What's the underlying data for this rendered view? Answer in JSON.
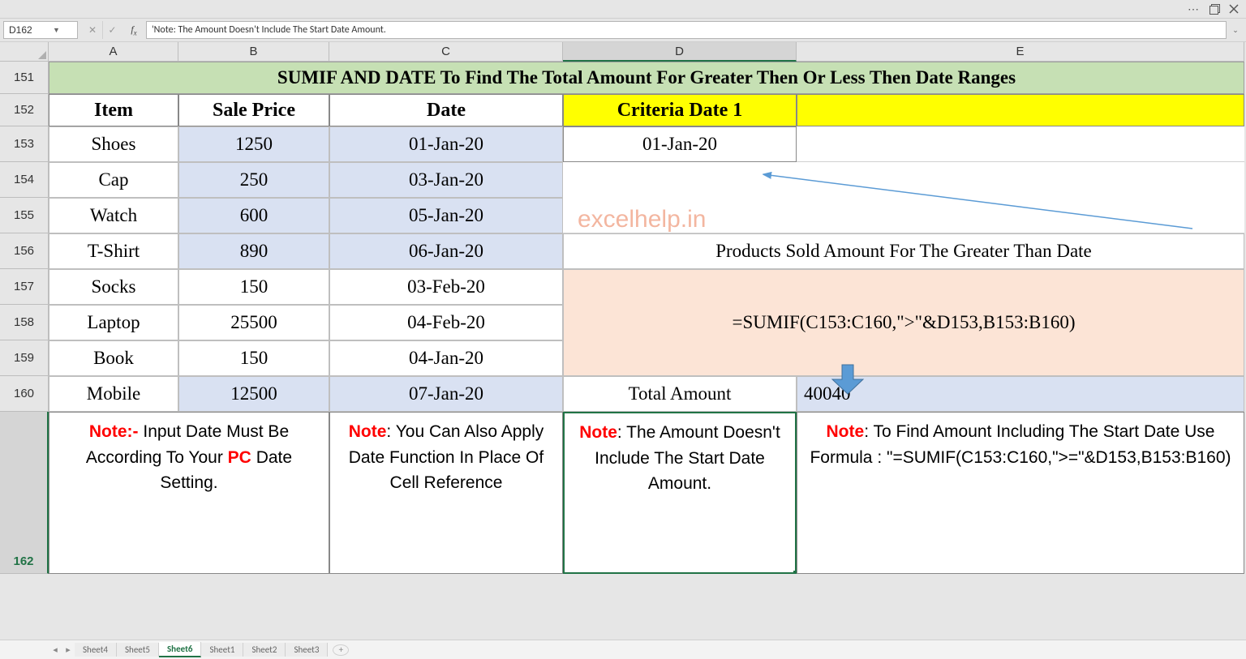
{
  "window": {
    "dots": "⋯"
  },
  "nameBox": "D162",
  "formulaBar": "'Note: The Amount Doesn't Include The Start Date Amount.",
  "columns": [
    "A",
    "B",
    "C",
    "D",
    "E"
  ],
  "rowNums": [
    "151",
    "152",
    "153",
    "154",
    "155",
    "156",
    "157",
    "158",
    "159",
    "160",
    "162"
  ],
  "title": "SUMIF AND DATE To Find The Total Amount For Greater Then Or Less Then Date Ranges",
  "headers": {
    "item": "Item",
    "sale": "Sale Price",
    "date": "Date",
    "crit": "Criteria Date 1"
  },
  "criteriaDateValue": "01-Jan-20",
  "productsLabel": "Products Sold Amount For The Greater Than Date",
  "formulaShown": "=SUMIF(C153:C160,\">\"&D153,B153:B160)",
  "totalLabel": "Total Amount",
  "totalValue": "40040",
  "watermark": "excelhelp.in",
  "rows": [
    {
      "item": "Shoes",
      "price": "1250",
      "date": "01-Jan-20",
      "blue": true
    },
    {
      "item": "Cap",
      "price": "250",
      "date": "03-Jan-20",
      "blue": true
    },
    {
      "item": "Watch",
      "price": "600",
      "date": "05-Jan-20",
      "blue": true
    },
    {
      "item": "T-Shirt",
      "price": "890",
      "date": "06-Jan-20",
      "blue": true
    },
    {
      "item": "Socks",
      "price": "150",
      "date": "03-Feb-20",
      "blue": false
    },
    {
      "item": "Laptop",
      "price": "25500",
      "date": "04-Feb-20",
      "blue": false
    },
    {
      "item": "Book",
      "price": "150",
      "date": "04-Jan-20",
      "blue": false
    },
    {
      "item": "Mobile",
      "price": "12500",
      "date": "07-Jan-20",
      "blue": true
    }
  ],
  "notes": {
    "ab": {
      "prefix": "Note:- ",
      "body": "Input Date Must Be According To Your ",
      "pc": "PC",
      "tail": " Date Setting."
    },
    "c": {
      "prefix": "Note",
      "body": ": You Can Also Apply Date Function In Place Of Cell Reference"
    },
    "d": {
      "prefix": "Note",
      "body": ": The Amount Doesn't Include The Start Date Amount."
    },
    "e": {
      "prefix": "Note",
      "body": ": To Find Amount Including The Start Date Use Formula : \"=SUMIF(C153:C160,\">=\"&D153,B153:B160)"
    }
  },
  "sheets": {
    "list": [
      "Sheet4",
      "Sheet5",
      "Sheet6",
      "Sheet1",
      "Sheet2",
      "Sheet3"
    ],
    "active": "Sheet6"
  }
}
